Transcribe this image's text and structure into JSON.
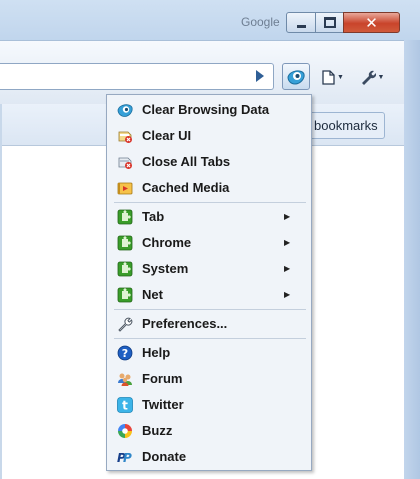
{
  "window": {
    "title_brand": "Google",
    "close_glyph": "✕"
  },
  "toolbar": {
    "address_value": "",
    "go_icon": "go-arrow-icon",
    "extension_icon": "extension-eye-icon",
    "page_icon": "page-menu-icon",
    "tools_icon": "wrench-menu-icon"
  },
  "bookmarks": {
    "label": "bookmarks"
  },
  "menu": {
    "items": [
      {
        "label": "Clear Browsing Data",
        "icon": "extension-eye-icon"
      },
      {
        "label": "Clear UI",
        "icon": "clear-ui-icon"
      },
      {
        "label": "Close All Tabs",
        "icon": "close-tabs-icon"
      },
      {
        "label": "Cached Media",
        "icon": "cached-media-icon"
      },
      {
        "label": "Tab",
        "icon": "puzzle-icon",
        "submenu": true
      },
      {
        "label": "Chrome",
        "icon": "puzzle-icon",
        "submenu": true
      },
      {
        "label": "System",
        "icon": "puzzle-icon",
        "submenu": true
      },
      {
        "label": "Net",
        "icon": "puzzle-icon",
        "submenu": true
      },
      {
        "label": "Preferences...",
        "icon": "wrench-icon"
      },
      {
        "label": "Help",
        "icon": "help-icon"
      },
      {
        "label": "Forum",
        "icon": "forum-icon"
      },
      {
        "label": "Twitter",
        "icon": "twitter-icon"
      },
      {
        "label": "Buzz",
        "icon": "buzz-icon"
      },
      {
        "label": "Donate",
        "icon": "paypal-icon"
      }
    ],
    "submenu_arrow": "▶"
  },
  "colors": {
    "accent": "#2f86c9",
    "puzzle_green": "#3a9d2a",
    "close_red": "#c9442b"
  }
}
